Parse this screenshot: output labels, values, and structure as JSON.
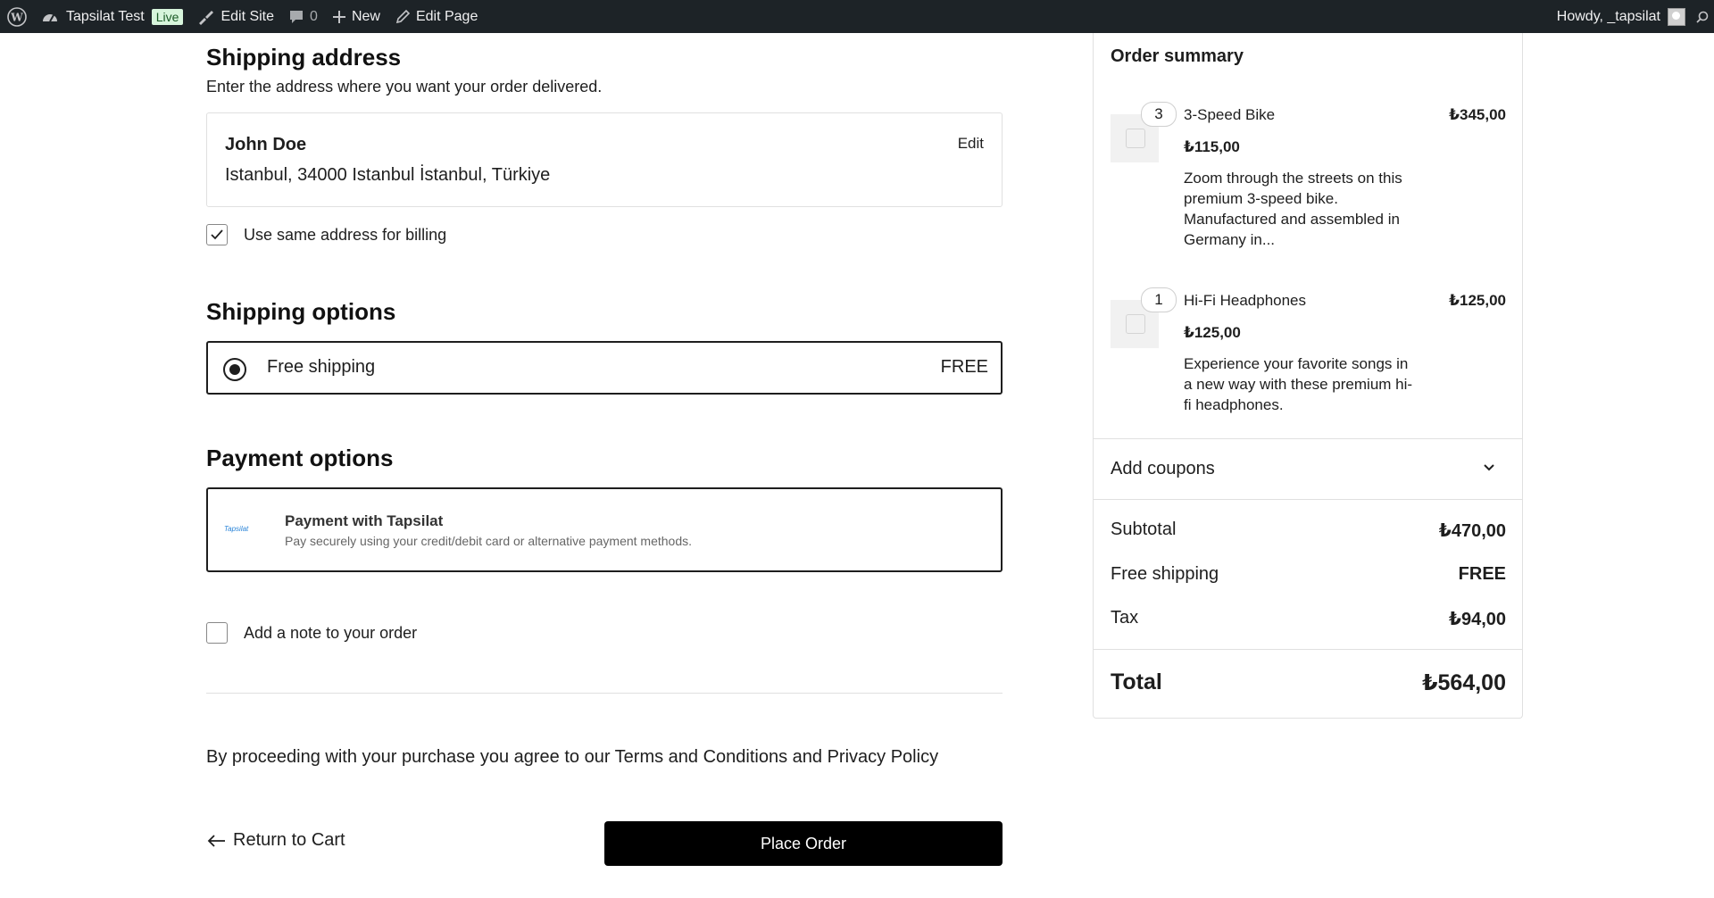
{
  "admin_bar": {
    "site_name": "Tapsilat Test",
    "live_badge": "Live",
    "edit_site": "Edit Site",
    "comments_count": "0",
    "new_label": "New",
    "edit_page": "Edit Page",
    "greeting": "Howdy, _tapsilat"
  },
  "shipping_address": {
    "title": "Shipping address",
    "description": "Enter the address where you want your order delivered.",
    "name": "John Doe",
    "address": "Istanbul, 34000 Istanbul İstanbul, Türkiye",
    "edit_label": "Edit",
    "same_billing_label": "Use same address for billing",
    "same_billing_checked": true
  },
  "shipping_options": {
    "title": "Shipping options",
    "option_label": "Free shipping",
    "option_price": "FREE"
  },
  "payment_options": {
    "title": "Payment options",
    "logo_text": "Tapsilat",
    "method_title": "Payment with Tapsilat",
    "method_description": "Pay securely using your credit/debit card or alternative payment methods."
  },
  "order_note": {
    "label": "Add a note to your order",
    "checked": false
  },
  "terms": "By proceeding with your purchase you agree to our Terms and Conditions and Privacy Policy",
  "actions": {
    "return_label": "Return to Cart",
    "place_order_label": "Place Order"
  },
  "order_summary": {
    "title": "Order summary",
    "items": [
      {
        "quantity": "3",
        "name": "3-Speed Bike",
        "total": "₺345,00",
        "unit_price": "₺115,00",
        "description": [
          "Zoom through the streets on this",
          "premium 3-speed bike.",
          "Manufactured and assembled in",
          "Germany in..."
        ]
      },
      {
        "quantity": "1",
        "name": "Hi-Fi Headphones",
        "total": "₺125,00",
        "unit_price": "₺125,00",
        "description": [
          "Experience your favorite songs in",
          "a new way with these premium hi-",
          "fi headphones."
        ]
      }
    ],
    "coupons_label": "Add coupons",
    "subtotal_label": "Subtotal",
    "subtotal_value": "₺470,00",
    "shipping_label": "Free shipping",
    "shipping_value": "FREE",
    "tax_label": "Tax",
    "tax_value": "₺94,00",
    "total_label": "Total",
    "total_value": "₺564,00"
  }
}
